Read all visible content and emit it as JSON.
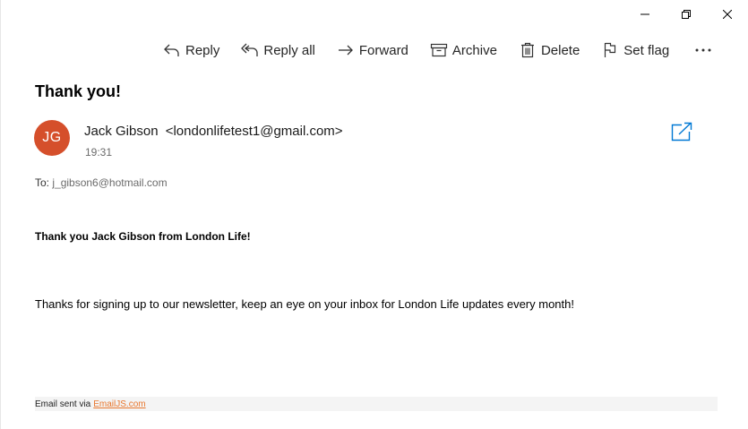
{
  "window": {
    "controls": [
      "minimize-icon",
      "restore-icon",
      "close-icon"
    ]
  },
  "toolbar": {
    "reply": "Reply",
    "reply_all": "Reply all",
    "forward": "Forward",
    "archive": "Archive",
    "delete": "Delete",
    "set_flag": "Set flag",
    "more_icon": "more-icon"
  },
  "message": {
    "subject": "Thank you!",
    "sender_initials": "JG",
    "sender_name": "Jack Gibson",
    "sender_address": "<londonlifetest1@gmail.com>",
    "time": "19:31",
    "to_label": "To:",
    "to_value": "j_gibson6@hotmail.com",
    "avatar_color": "#d54f2b",
    "accent_color": "#0078d4"
  },
  "body": {
    "headline": "Thank you Jack Gibson from London Life!",
    "text": "Thanks for signing up to our newsletter, keep an eye on your inbox for London Life updates every month!"
  },
  "footer": {
    "prefix": "Email sent via",
    "link_text": "EmailJS.com",
    "link_color": "#e8772e"
  }
}
